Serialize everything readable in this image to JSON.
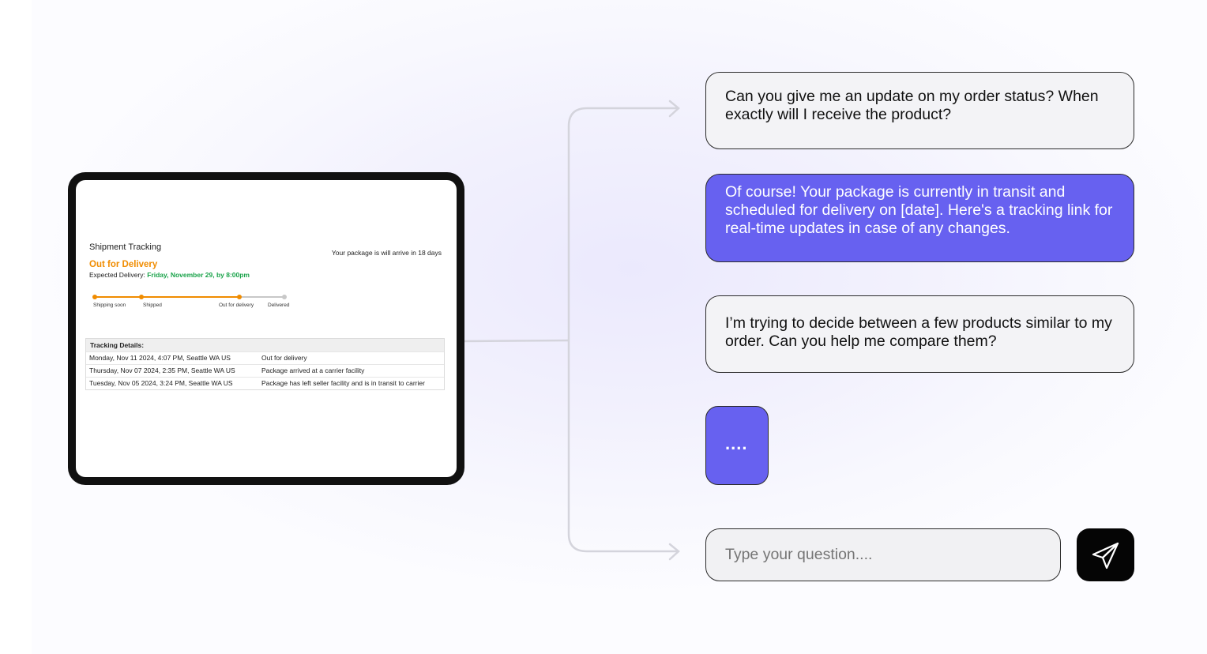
{
  "tracking": {
    "title": "Shipment Tracking",
    "arrival_note": "Your package is will arrive in 18 days",
    "status": "Out for Delivery",
    "expected_label": "Expected Delivery: ",
    "expected_date": "Friday, November 29, by 8:00pm",
    "steps": [
      "Shipping soon",
      "Shipped",
      "Out for delivery",
      "Delivered"
    ],
    "details_title": "Tracking Details:",
    "details": [
      {
        "when": "Monday, Nov 11 2024, 4:07 PM, Seattle WA US",
        "event": "Out for delivery"
      },
      {
        "when": "Thursday, Nov 07 2024, 2:35 PM, Seattle WA US",
        "event": "Package arrived at a carrier facility"
      },
      {
        "when": "Tuesday, Nov 05 2024, 3:24 PM, Seattle WA US",
        "event": "Package has left seller facility and is in transit to carrier"
      }
    ],
    "colors": {
      "status": "#f08c00",
      "date": "#1aa34a",
      "progress": "#f08c00",
      "pending": "#c8c8c8"
    }
  },
  "chat": {
    "messages": [
      {
        "role": "user",
        "text": "Can you give me an update on my order status? When exactly will I receive the product?"
      },
      {
        "role": "assistant",
        "text": "Of course! Your package is currently in transit and scheduled for delivery on [date]. Here's a tracking link for real-time updates in case of any changes."
      },
      {
        "role": "user",
        "text": "I’m trying to decide between a few products similar to my order. Can you help me compare them?"
      }
    ],
    "typing_indicator": "....",
    "input_placeholder": "Type your question....",
    "send_icon": "paper-plane-icon",
    "colors": {
      "assistant_bubble": "#6761f0",
      "user_bubble": "#f3f3f6",
      "send_button": "#050505"
    }
  }
}
